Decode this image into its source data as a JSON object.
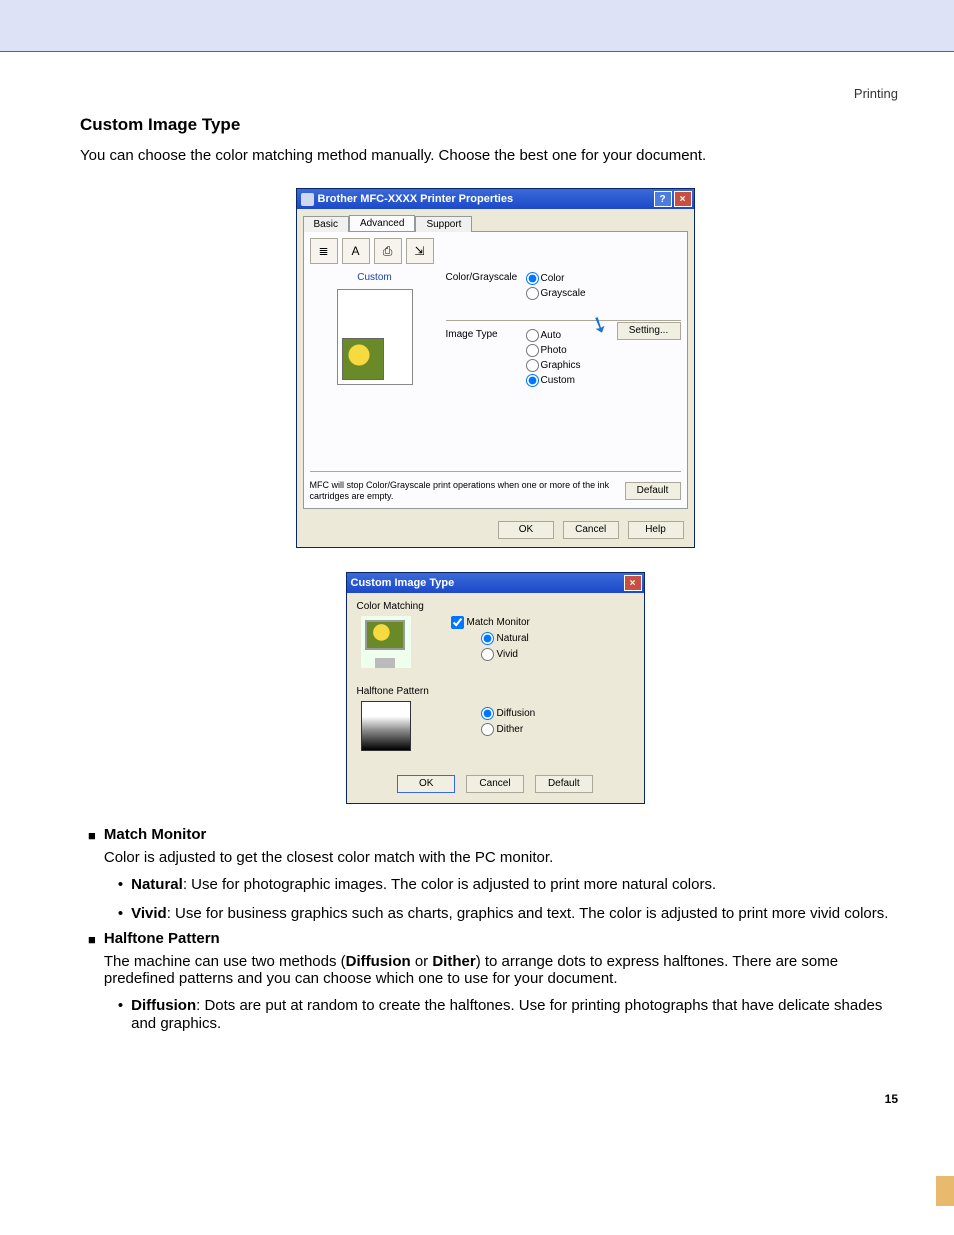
{
  "header": {
    "section": "Printing"
  },
  "title": "Custom Image Type",
  "intro": "You can choose the color matching method manually. Choose the best one for your document.",
  "dialog1": {
    "title": "Brother MFC-XXXX Printer Properties",
    "tabs": [
      "Basic",
      "Advanced",
      "Support"
    ],
    "preview_label": "Custom",
    "group1_label": "Color/Grayscale",
    "group1_options": [
      "Color",
      "Grayscale"
    ],
    "group2_label": "Image Type",
    "group2_options": [
      "Auto",
      "Photo",
      "Graphics",
      "Custom"
    ],
    "setting_btn": "Setting...",
    "note": "MFC will stop Color/Grayscale print operations when one or more of the ink cartridges are empty.",
    "default_btn": "Default",
    "ok": "OK",
    "cancel": "Cancel",
    "help": "Help"
  },
  "dialog2": {
    "title": "Custom Image Type",
    "sect1": "Color Matching",
    "match_monitor": "Match Monitor",
    "cm_options": [
      "Natural",
      "Vivid"
    ],
    "sect2": "Halftone Pattern",
    "hp_options": [
      "Diffusion",
      "Dither"
    ],
    "ok": "OK",
    "cancel": "Cancel",
    "default": "Default"
  },
  "body": {
    "mm_title": "Match Monitor",
    "mm_desc": "Color is adjusted to get the closest color match with the PC monitor.",
    "natural_b": "Natural",
    "natural_t": ": Use for photographic images. The color is adjusted to print more natural colors.",
    "vivid_b": "Vivid",
    "vivid_t": ": Use for business graphics such as charts, graphics and text. The color is adjusted to print more vivid colors.",
    "hp_title": "Halftone Pattern",
    "hp_desc1": "The machine can use two methods (",
    "hp_desc_b1": "Diffusion",
    "hp_desc_mid": " or ",
    "hp_desc_b2": "Dither",
    "hp_desc2": ") to arrange dots to express halftones. There are some predefined patterns and you can choose which one to use for your document.",
    "diff_b": "Diffusion",
    "diff_t": ": Dots are put at random to create the halftones. Use for printing photographs that have delicate shades and graphics."
  },
  "page_number": "15"
}
